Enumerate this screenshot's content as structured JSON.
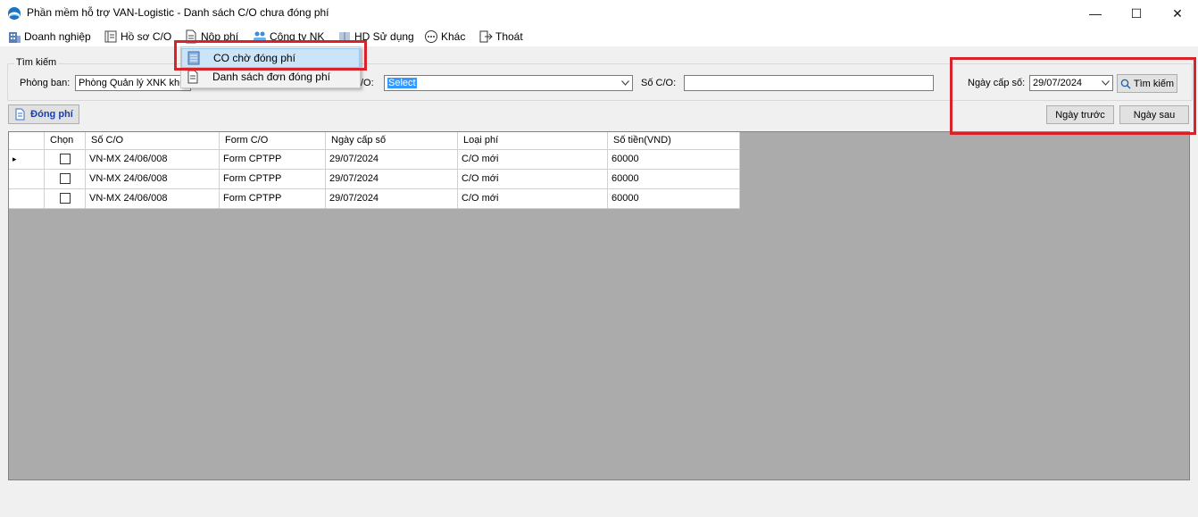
{
  "window": {
    "title": "Phần mềm hỗ trợ VAN-Logistic - Danh sách C/O chưa đóng phí",
    "minimize": "—",
    "maximize": "☐",
    "close": "✕"
  },
  "menu": {
    "items": [
      {
        "label": "Doanh nghiệp",
        "icon": "building-icon"
      },
      {
        "label": "Hồ sơ C/O",
        "icon": "folder-icon"
      },
      {
        "label": "Nộp phí",
        "icon": "document-icon"
      },
      {
        "label": "Công ty NK",
        "icon": "company-icon"
      },
      {
        "label": "HD Sử dụng",
        "icon": "book-icon"
      },
      {
        "label": "Khác",
        "icon": "more-icon"
      },
      {
        "label": "Thoát",
        "icon": "exit-icon"
      }
    ]
  },
  "dropdown": {
    "items": [
      {
        "label": "CO chờ đóng phí"
      },
      {
        "label": "Danh sách đơn đóng phí"
      }
    ]
  },
  "search": {
    "legend": "Tìm kiếm",
    "department_label": "Phòng ban:",
    "department_value": "Phòng Quản lý XNK khu",
    "co_type_label": "/O:",
    "co_type_value": "Select",
    "co_number_label": "Số C/O:",
    "co_number_value": "",
    "issue_date_label": "Ngày cấp số:",
    "issue_date_value": "29/07/2024",
    "search_button": "Tìm kiếm",
    "prev_day_button": "Ngày trước",
    "next_day_button": "Ngày sau"
  },
  "toolbar": {
    "pay_button": "Đóng phí"
  },
  "table": {
    "columns": [
      "Chọn",
      "Số C/O",
      "Form C/O",
      "Ngày cấp số",
      "Loại phí",
      "Số tiền(VND)"
    ],
    "rows": [
      {
        "co_number": "VN-MX 24/06/008",
        "form": "Form CPTPP",
        "date": "29/07/2024",
        "fee_type": "C/O mới",
        "amount": "60000"
      },
      {
        "co_number": "VN-MX 24/06/008",
        "form": "Form CPTPP",
        "date": "29/07/2024",
        "fee_type": "C/O mới",
        "amount": "60000"
      },
      {
        "co_number": "VN-MX 24/06/008",
        "form": "Form CPTPP",
        "date": "29/07/2024",
        "fee_type": "C/O mới",
        "amount": "60000"
      }
    ],
    "row_indicator": "▸"
  },
  "colors": {
    "highlight_red": "#d8232a",
    "selection_blue": "#3399ff",
    "menu_hover": "#cce4f7",
    "grid_background": "#ababab"
  }
}
